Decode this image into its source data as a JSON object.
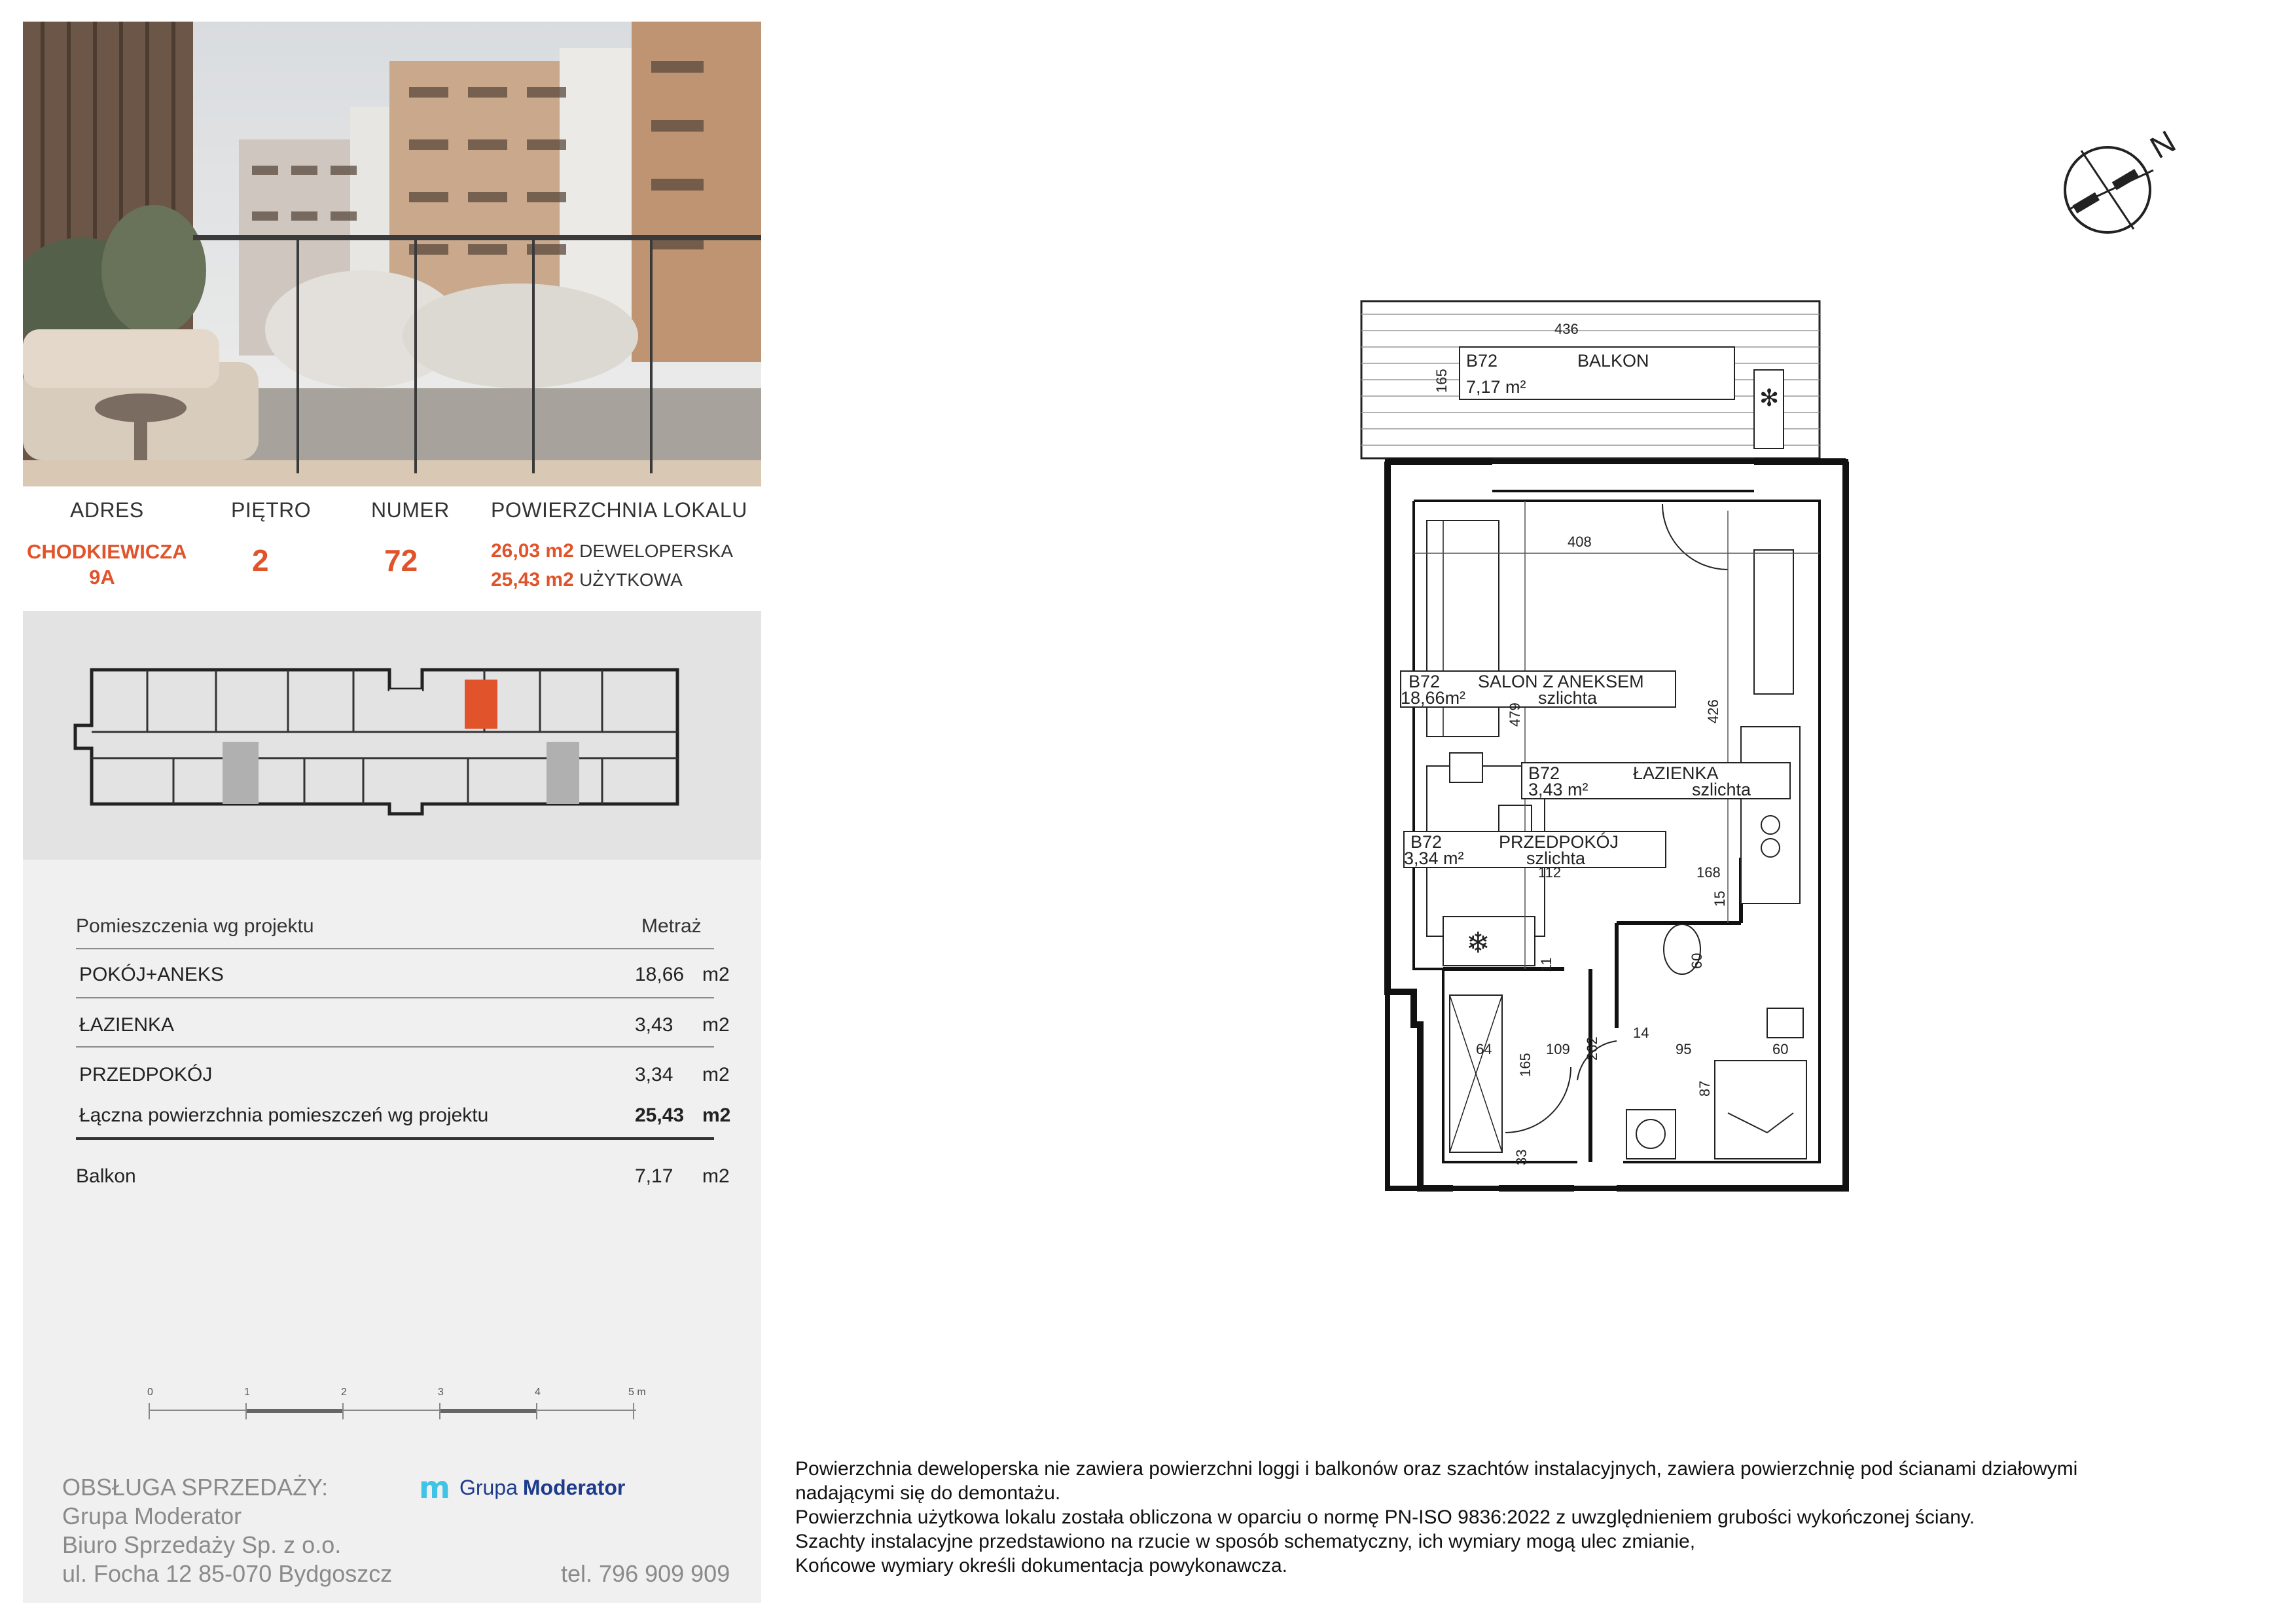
{
  "info": {
    "address_label": "ADRES",
    "floor_label": "PIĘTRO",
    "number_label": "NUMER",
    "area_label": "POWIERZCHNIA LOKALU",
    "address_line1": "CHODKIEWICZA",
    "address_line2": "9A",
    "floor": "2",
    "number": "72",
    "dev_area_value": "26,03 m2",
    "dev_area_label": "DEWELOPERSKA",
    "usable_area_value": "25,43 m2",
    "usable_area_label": "UŻYTKOWA"
  },
  "rooms_table": {
    "header_name": "Pomieszczenia wg projektu",
    "header_area": "Metraż",
    "rows": [
      {
        "name": "POKÓJ+ANEKS",
        "value": "18,66",
        "unit": "m2"
      },
      {
        "name": "ŁAZIENKA",
        "value": "3,43",
        "unit": "m2"
      },
      {
        "name": "PRZEDPOKÓJ",
        "value": "3,34",
        "unit": "m2"
      }
    ],
    "total": {
      "name": "Łączna powierzchnia pomieszczeń wg projektu",
      "value": "25,43",
      "unit": "m2"
    },
    "balcony": {
      "name": "Balkon",
      "value": "7,17",
      "unit": "m2"
    }
  },
  "scale": {
    "ticks": [
      "0",
      "1",
      "2",
      "3",
      "4",
      "5 m"
    ]
  },
  "sales": {
    "heading": "OBSŁUGA SPRZEDAŻY:",
    "line1": "Grupa Moderator",
    "line2": "Biuro Sprzedaży Sp. z o.o.",
    "line3": "ul. Focha 12 85-070 Bydgoszcz",
    "phone": "tel. 796 909 909",
    "logo_mark": "m",
    "logo_text_1": "Grupa",
    "logo_text_2": "Moderator"
  },
  "notes": [
    "Powierzchnia deweloperska nie zawiera powierzchni loggi i balkonów oraz szachtów instalacyjnych, zawiera powierzchnię pod ścianami działowymi",
    "nadającymi się do demontażu.",
    "Powierzchnia użytkowa lokalu została obliczona w oparciu o normę PN-ISO 9836:2022 z uwzględnieniem grubości wykończonej ściany.",
    "Szachty instalacyjne przedstawiono na rzucie w sposób schematyczny, ich wymiary mogą ulec zmianie,",
    "Końcowe wymiary określi dokumentacja powykonawcza."
  ],
  "plan": {
    "compass": "N",
    "balcony": {
      "code": "B72",
      "name": "BALKON",
      "area": "7,17 m²"
    },
    "salon": {
      "code": "B72",
      "name": "SALON Z ANEKSEM",
      "area": "18,66m²",
      "finish": "szlichta"
    },
    "bath": {
      "code": "B72",
      "name": "ŁAZIENKA",
      "area": "3,43 m²",
      "finish": "szlichta"
    },
    "hall": {
      "code": "B72",
      "name": "PRZEDPOKÓJ",
      "area": "3,34 m²",
      "finish": "szlichta"
    },
    "dims": [
      "436",
      "165",
      "408",
      "479",
      "426",
      "168",
      "11",
      "60",
      "64",
      "165",
      "109",
      "262",
      "14",
      "95",
      "87",
      "60",
      "33",
      "15",
      "112"
    ]
  },
  "colors": {
    "accent": "#e0532b",
    "panel_gray": "#e3e3e3",
    "panel_light": "#f0f0f0",
    "logo_blue": "#1d3b8c",
    "logo_cyan": "#3fc3e6"
  }
}
